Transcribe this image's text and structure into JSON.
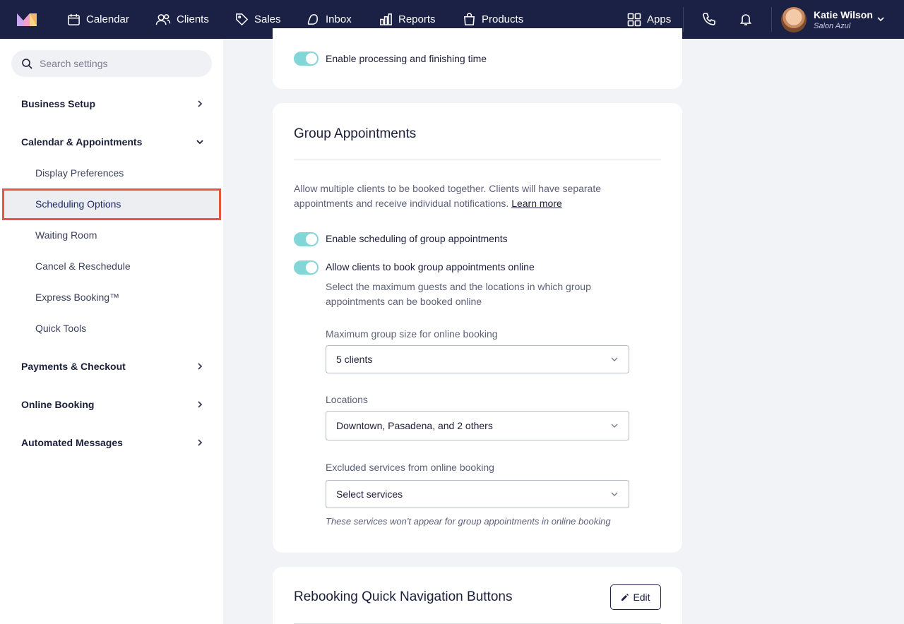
{
  "nav": {
    "items": [
      {
        "label": "Calendar",
        "icon": "calendar-icon"
      },
      {
        "label": "Clients",
        "icon": "clients-icon"
      },
      {
        "label": "Sales",
        "icon": "tag-icon"
      },
      {
        "label": "Inbox",
        "icon": "inbox-icon"
      },
      {
        "label": "Reports",
        "icon": "reports-icon"
      },
      {
        "label": "Products",
        "icon": "bag-icon"
      }
    ],
    "apps_label": "Apps",
    "user": {
      "name": "Katie Wilson",
      "business": "Salon Azul"
    }
  },
  "sidebar": {
    "search_placeholder": "Search settings",
    "sections": [
      {
        "label": "Business Setup"
      },
      {
        "label": "Calendar & Appointments"
      },
      {
        "label": "Payments & Checkout"
      },
      {
        "label": "Online Booking"
      },
      {
        "label": "Automated Messages"
      }
    ],
    "calendar_subitems": [
      {
        "label": "Display Preferences"
      },
      {
        "label": "Scheduling Options",
        "selected": true
      },
      {
        "label": "Waiting Room"
      },
      {
        "label": "Cancel & Reschedule"
      },
      {
        "label": "Express Booking™"
      },
      {
        "label": "Quick Tools"
      }
    ]
  },
  "processing_card": {
    "toggle_label": "Enable processing and finishing time",
    "toggle_on": true
  },
  "group_card": {
    "title": "Group Appointments",
    "description": "Allow multiple clients to be booked together. Clients will have separate appointments and receive individual notifications.",
    "learn_more": "Learn more",
    "toggle_scheduling_label": "Enable scheduling of group appointments",
    "toggle_online_label": "Allow clients to book group appointments online",
    "online_help": "Select the maximum guests and the locations in which group appointments can be booked online",
    "max_size_label": "Maximum group size for online booking",
    "max_size_value": "5 clients",
    "locations_label": "Locations",
    "locations_value": "Downtown, Pasadena, and 2 others",
    "excluded_label": "Excluded services from online booking",
    "excluded_placeholder": "Select services",
    "excluded_hint": "These services won't appear for group appointments in online booking"
  },
  "rebooking_card": {
    "title": "Rebooking Quick Navigation Buttons",
    "edit_label": "Edit"
  },
  "colors": {
    "nav_bg": "#1b2045",
    "toggle_on": "#83d6d7",
    "highlight_border": "#e2573f"
  }
}
